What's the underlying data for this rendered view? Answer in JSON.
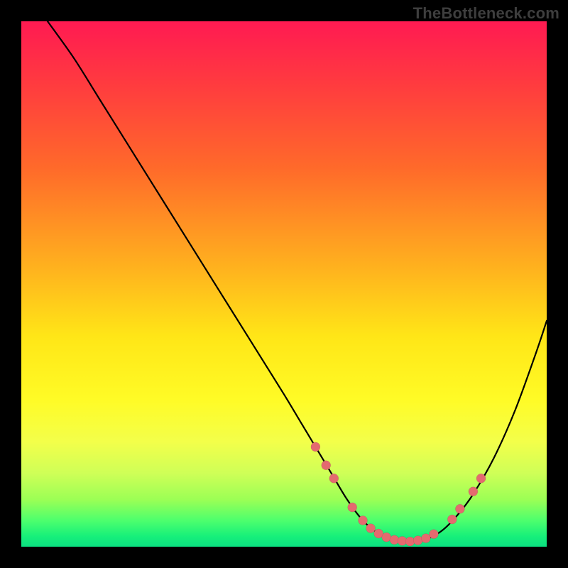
{
  "watermark": "TheBottleneck.com",
  "chart_data": {
    "type": "line",
    "title": "",
    "xlabel": "",
    "ylabel": "",
    "xlim": [
      0,
      100
    ],
    "ylim": [
      0,
      100
    ],
    "grid": false,
    "legend": false,
    "series": [
      {
        "name": "bottleneck-curve",
        "x": [
          5,
          10,
          15,
          20,
          25,
          30,
          35,
          40,
          45,
          50,
          53,
          56,
          59,
          62,
          65,
          68,
          71,
          74,
          77,
          80,
          83,
          86,
          90,
          94,
          98,
          100
        ],
        "y": [
          100,
          93,
          85,
          77,
          69,
          61,
          53,
          45,
          37,
          29,
          24,
          19,
          14,
          9,
          5,
          2.5,
          1.2,
          1.0,
          1.4,
          3,
          6,
          10,
          17,
          26,
          37,
          43
        ],
        "color": "#000000"
      }
    ],
    "markers": {
      "name": "highlight-points",
      "color": "#e46a6f",
      "points": [
        {
          "x": 56,
          "y": 19
        },
        {
          "x": 58,
          "y": 15.5
        },
        {
          "x": 59.5,
          "y": 13
        },
        {
          "x": 63,
          "y": 7.5
        },
        {
          "x": 65,
          "y": 5
        },
        {
          "x": 66.5,
          "y": 3.5
        },
        {
          "x": 68,
          "y": 2.5
        },
        {
          "x": 69.5,
          "y": 1.8
        },
        {
          "x": 71,
          "y": 1.3
        },
        {
          "x": 72.5,
          "y": 1.1
        },
        {
          "x": 74,
          "y": 1.0
        },
        {
          "x": 75.5,
          "y": 1.2
        },
        {
          "x": 77,
          "y": 1.6
        },
        {
          "x": 78.5,
          "y": 2.4
        },
        {
          "x": 82,
          "y": 5.2
        },
        {
          "x": 83.5,
          "y": 7.2
        },
        {
          "x": 86,
          "y": 10.5
        },
        {
          "x": 87.5,
          "y": 13
        }
      ]
    }
  }
}
